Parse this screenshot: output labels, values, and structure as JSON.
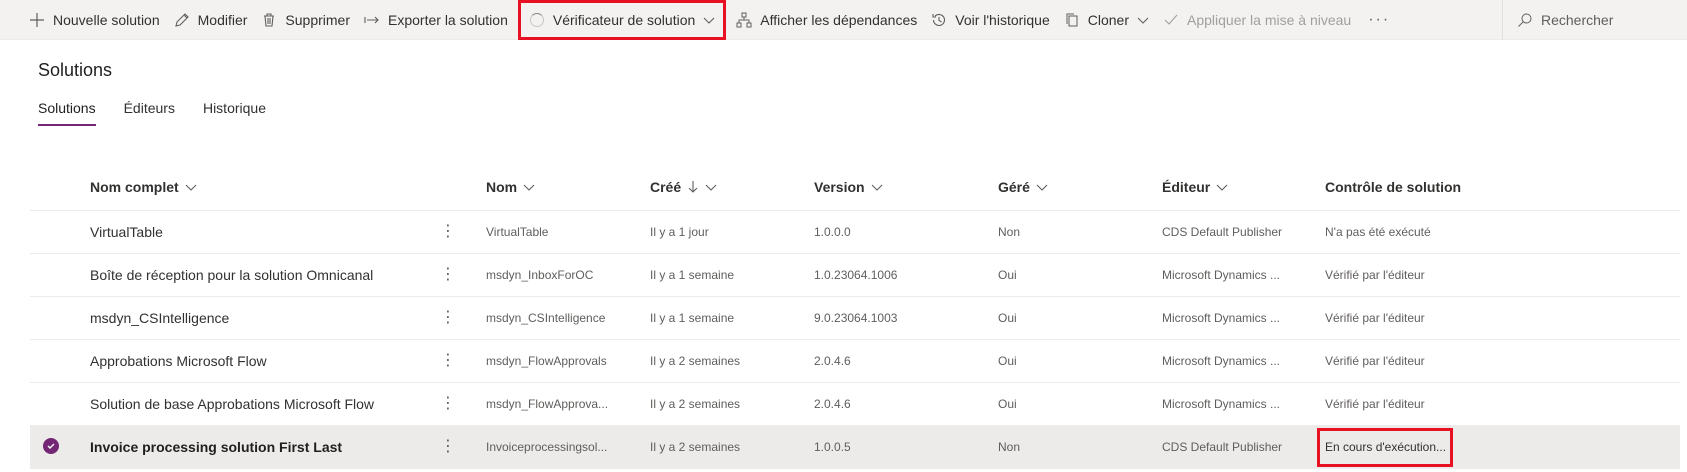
{
  "commandbar": {
    "new_solution": "Nouvelle solution",
    "edit": "Modifier",
    "delete": "Supprimer",
    "export": "Exporter la solution",
    "checker": "Vérificateur de solution",
    "dependencies": "Afficher les dépendances",
    "history": "Voir l'historique",
    "clone": "Cloner",
    "apply_upgrade": "Appliquer la mise à niveau",
    "more": "···",
    "search": "Rechercher"
  },
  "page": {
    "title": "Solutions",
    "tabs": [
      {
        "label": "Solutions",
        "active": true
      },
      {
        "label": "Éditeurs",
        "active": false
      },
      {
        "label": "Historique",
        "active": false
      }
    ]
  },
  "grid": {
    "columns": {
      "name": "Nom complet",
      "nom": "Nom",
      "cree": "Créé",
      "version": "Version",
      "gere": "Géré",
      "editeur": "Éditeur",
      "controle": "Contrôle de solution"
    },
    "rows": [
      {
        "name": "VirtualTable",
        "nom": "VirtualTable",
        "cree": "Il y a 1 jour",
        "version": "1.0.0.0",
        "gere": "Non",
        "editeur": "CDS Default Publisher",
        "controle": "N'a pas été exécuté"
      },
      {
        "name": "Boîte de réception pour la solution Omnicanal",
        "nom": "msdyn_InboxForOC",
        "cree": "Il y a 1 semaine",
        "version": "1.0.23064.1006",
        "gere": "Oui",
        "editeur": "Microsoft Dynamics ...",
        "controle": "Vérifié par l'éditeur"
      },
      {
        "name": "msdyn_CSIntelligence",
        "nom": "msdyn_CSIntelligence",
        "cree": "Il y a 1 semaine",
        "version": "9.0.23064.1003",
        "gere": "Oui",
        "editeur": "Microsoft Dynamics ...",
        "controle": "Vérifié par l'éditeur"
      },
      {
        "name": "Approbations Microsoft Flow",
        "nom": "msdyn_FlowApprovals",
        "cree": "Il y a 2 semaines",
        "version": "2.0.4.6",
        "gere": "Oui",
        "editeur": "Microsoft Dynamics ...",
        "controle": "Vérifié par l'éditeur"
      },
      {
        "name": "Solution de base Approbations Microsoft Flow",
        "nom": "msdyn_FlowApprova...",
        "cree": "Il y a 2 semaines",
        "version": "2.0.4.6",
        "gere": "Oui",
        "editeur": "Microsoft Dynamics ...",
        "controle": "Vérifié par l'éditeur"
      },
      {
        "name": "Invoice processing solution First Last",
        "nom": "Invoiceprocessingsol...",
        "cree": "Il y a 2 semaines",
        "version": "1.0.0.5",
        "gere": "Non",
        "editeur": "CDS Default Publisher",
        "controle": "En cours d'exécution..."
      }
    ]
  },
  "colors": {
    "accent": "#742774",
    "highlight": "#e81123",
    "commandbar_bg": "#f3f2f1"
  }
}
